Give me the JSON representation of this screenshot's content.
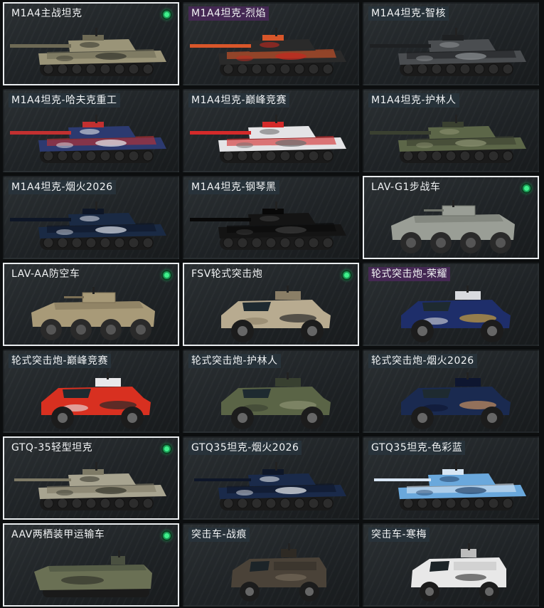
{
  "vehicles": [
    {
      "name": "M1A4主战坦克",
      "owned": true,
      "kind": "tank",
      "colors": [
        "#9a9478",
        "#6e6a55",
        "#3a3a30"
      ],
      "tag": "none"
    },
    {
      "name": "M1A4坦克-烈焰",
      "owned": false,
      "kind": "tank",
      "colors": [
        "#2a2a2a",
        "#d8562a",
        "#c22a20"
      ],
      "tag": "purple"
    },
    {
      "name": "M1A4坦克-智核",
      "owned": false,
      "kind": "tank",
      "colors": [
        "#4a4d50",
        "#1e2022",
        "#8a8d90"
      ],
      "tag": "plain"
    },
    {
      "name": "M1A4坦克-哈夫克重工",
      "owned": false,
      "kind": "tank",
      "colors": [
        "#2c3a70",
        "#c23030",
        "#e0e2e6"
      ],
      "tag": "plain"
    },
    {
      "name": "M1A4坦克-巅峰竞赛",
      "owned": false,
      "kind": "tank",
      "colors": [
        "#e4e4e6",
        "#d42a2a",
        "#707070"
      ],
      "tag": "plain"
    },
    {
      "name": "M1A4坦克-护林人",
      "owned": false,
      "kind": "tank",
      "colors": [
        "#5c6648",
        "#3a4030",
        "#8a9070"
      ],
      "tag": "plain"
    },
    {
      "name": "M1A4坦克-烟火2026",
      "owned": false,
      "kind": "tank",
      "colors": [
        "#1a2a44",
        "#0e1626",
        "#d0d6e0"
      ],
      "tag": "plain"
    },
    {
      "name": "M1A4坦克-钢琴黑",
      "owned": false,
      "kind": "tank",
      "colors": [
        "#141414",
        "#080808",
        "#3a3a3a"
      ],
      "tag": "plain"
    },
    {
      "name": "LAV-G1步战车",
      "owned": true,
      "kind": "apc",
      "colors": [
        "#9a9e96",
        "#6e726a",
        "#2a2a2a"
      ],
      "tag": "none"
    },
    {
      "name": "LAV-AA防空车",
      "owned": true,
      "kind": "apc",
      "colors": [
        "#a89a78",
        "#7a6e54",
        "#2a2a2a"
      ],
      "tag": "none"
    },
    {
      "name": "FSV轮式突击炮",
      "owned": true,
      "kind": "fsv",
      "colors": [
        "#b8ab90",
        "#8a7e66",
        "#2a2a2a"
      ],
      "tag": "none"
    },
    {
      "name": "轮式突击炮-荣耀",
      "owned": false,
      "kind": "fsv",
      "colors": [
        "#1e2e6a",
        "#d8dade",
        "#c8a040"
      ],
      "tag": "purple"
    },
    {
      "name": "轮式突击炮-巅峰竞赛",
      "owned": false,
      "kind": "fsv",
      "colors": [
        "#d83020",
        "#e8e8ea",
        "#2a2a2a"
      ],
      "tag": "plain"
    },
    {
      "name": "轮式突击炮-护林人",
      "owned": false,
      "kind": "fsv",
      "colors": [
        "#5a6446",
        "#384030",
        "#8a9070"
      ],
      "tag": "plain"
    },
    {
      "name": "轮式突击炮-烟火2026",
      "owned": false,
      "kind": "fsv",
      "colors": [
        "#1a2a50",
        "#0e1630",
        "#c89060"
      ],
      "tag": "plain"
    },
    {
      "name": "GTQ-35轻型坦克",
      "owned": true,
      "kind": "ltank",
      "colors": [
        "#a8a490",
        "#7e7a66",
        "#3a3a30"
      ],
      "tag": "none"
    },
    {
      "name": "GTQ35坦克-烟火2026",
      "owned": false,
      "kind": "ltank",
      "colors": [
        "#1a2a4a",
        "#0e1628",
        "#e0e4ea"
      ],
      "tag": "plain"
    },
    {
      "name": "GTQ35坦克-色彩蓝",
      "owned": false,
      "kind": "ltank",
      "colors": [
        "#6aa8dc",
        "#d8e6f4",
        "#2a4a70"
      ],
      "tag": "plain"
    },
    {
      "name": "AAV两栖装甲运输车",
      "owned": true,
      "kind": "aav",
      "colors": [
        "#6a7054",
        "#4a5040",
        "#2a2a24"
      ],
      "tag": "none"
    },
    {
      "name": "突击车-战痕",
      "owned": false,
      "kind": "mrap",
      "colors": [
        "#4a4238",
        "#2e2a24",
        "#7a6e5e"
      ],
      "tag": "plain"
    },
    {
      "name": "突击车-寒梅",
      "owned": false,
      "kind": "mrap",
      "colors": [
        "#e8e8e8",
        "#bcbcbc",
        "#2a2a2a"
      ],
      "tag": "plain"
    }
  ]
}
